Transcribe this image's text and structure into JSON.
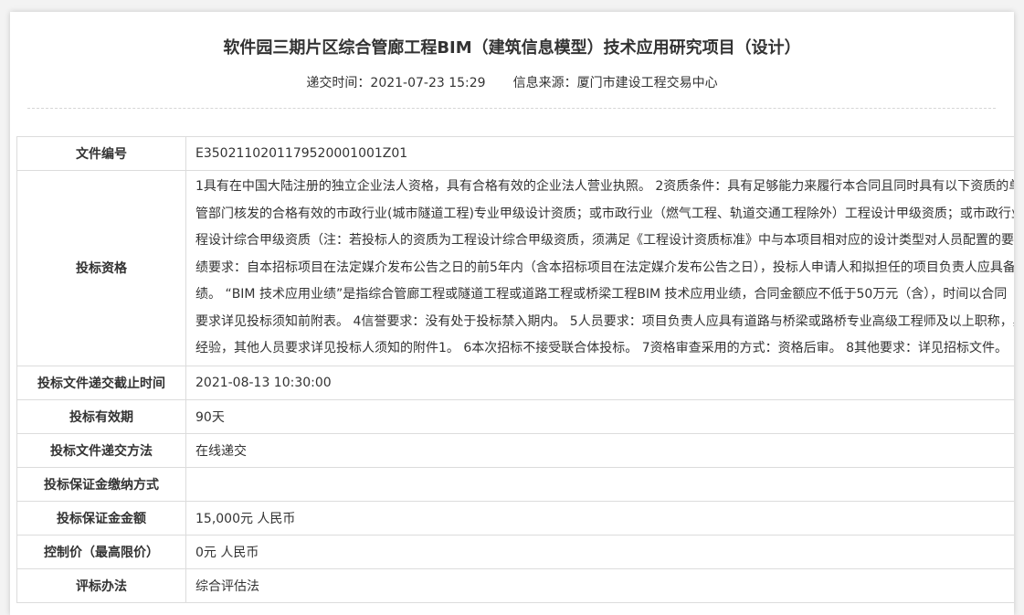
{
  "header": {
    "title": "软件园三期片区综合管廊工程BIM（建筑信息模型）技术应用研究项目（设计）",
    "submit_label": "递交时间：",
    "submit_time": "2021-07-23 15:29",
    "source_label": "信息来源：",
    "source": "厦门市建设工程交易中心"
  },
  "rows": {
    "file_no": {
      "label": "文件编号",
      "value": "E3502110201179520001001Z01"
    },
    "qualification": {
      "label": "投标资格",
      "lines": [
        "1具有在中国大陆注册的独立企业法人资格，具有合格有效的企业法人营业执照。 2资质条件：具有足够能力来履行本合同且同时具有以下资质的单",
        "管部门核发的合格有效的市政行业(城市隧道工程)专业甲级设计资质；或市政行业（燃气工程、轨道交通工程除外）工程设计甲级资质；或市政行业",
        "程设计综合甲级资质（注：若投标人的资质为工程设计综合甲级资质，须满足《工程设计资质标准》中与本项目相对应的设计类型对人员配置的要",
        "绩要求：自本招标项目在法定媒介发布公告之日的前5年内（含本招标项目在法定媒介发布公告之日），投标人申请人和拟担任的项目负责人应具备",
        "绩。 “BIM 技术应用业绩”是指综合管廊工程或隧道工程或道路工程或桥梁工程BIM 技术应用业绩，合同金额应不低于50万元（含），时间以合同",
        "要求详见投标须知前附表。 4信誉要求：没有处于投标禁入期内。 5人员要求：项目负责人应具有道路与桥梁或路桥专业高级工程师及以上职称，具",
        "经验，其他人员要求详见投标人须知的附件1。 6本次招标不接受联合体投标。 7资格审查采用的方式：资格后审。 8其他要求：详见招标文件。"
      ]
    },
    "deadline": {
      "label": "投标文件递交截止时间",
      "value": "2021-08-13 10:30:00"
    },
    "validity": {
      "label": "投标有效期",
      "value": "90天"
    },
    "submit_method": {
      "label": "投标文件递交方法",
      "value": "在线递交"
    },
    "deposit_method": {
      "label": "投标保证金缴纳方式",
      "value": ""
    },
    "deposit_amount": {
      "label": "投标保证金金额",
      "value": "15,000元 人民币"
    },
    "control_price": {
      "label": "控制价（最高限价）",
      "value": "0元 人民币"
    },
    "eval_method": {
      "label": "评标办法",
      "value": "综合评估法"
    }
  }
}
